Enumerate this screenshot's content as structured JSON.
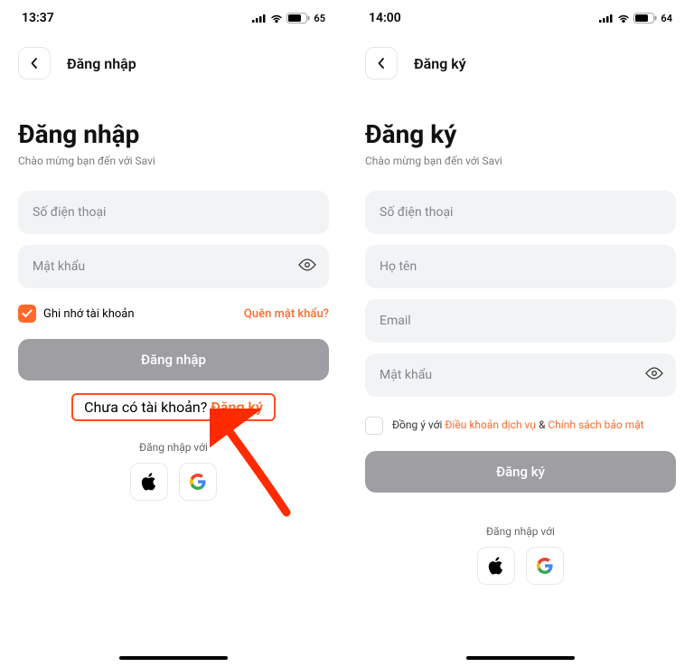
{
  "left": {
    "status_time": "13:37",
    "status_battery": "65",
    "topbar_title": "Đăng nhập",
    "heading": "Đăng nhập",
    "subheading": "Chào mừng bạn đến với Savi",
    "phone_placeholder": "Số điện thoại",
    "password_placeholder": "Mật khẩu",
    "remember_label": "Ghi nhớ tài khoản",
    "forgot_label": "Quên mật khẩu?",
    "submit_label": "Đăng nhập",
    "no_account_text": "Chưa có tài khoản? ",
    "no_account_link": "Đăng ký",
    "social_label": "Đăng nhập với"
  },
  "right": {
    "status_time": "14:00",
    "status_battery": "64",
    "topbar_title": "Đăng ký",
    "heading": "Đăng ký",
    "subheading": "Chào mừng bạn đến với Savi",
    "phone_placeholder": "Số điện thoại",
    "name_placeholder": "Họ tên",
    "email_placeholder": "Email",
    "password_placeholder": "Mật khẩu",
    "terms_prefix": "Đồng ý với ",
    "terms_link1": "Điều khoản dịch vụ",
    "terms_amp": " & ",
    "terms_link2": "Chính sách bảo mật",
    "submit_label": "Đăng ký",
    "social_label": "Đăng nhập với"
  }
}
